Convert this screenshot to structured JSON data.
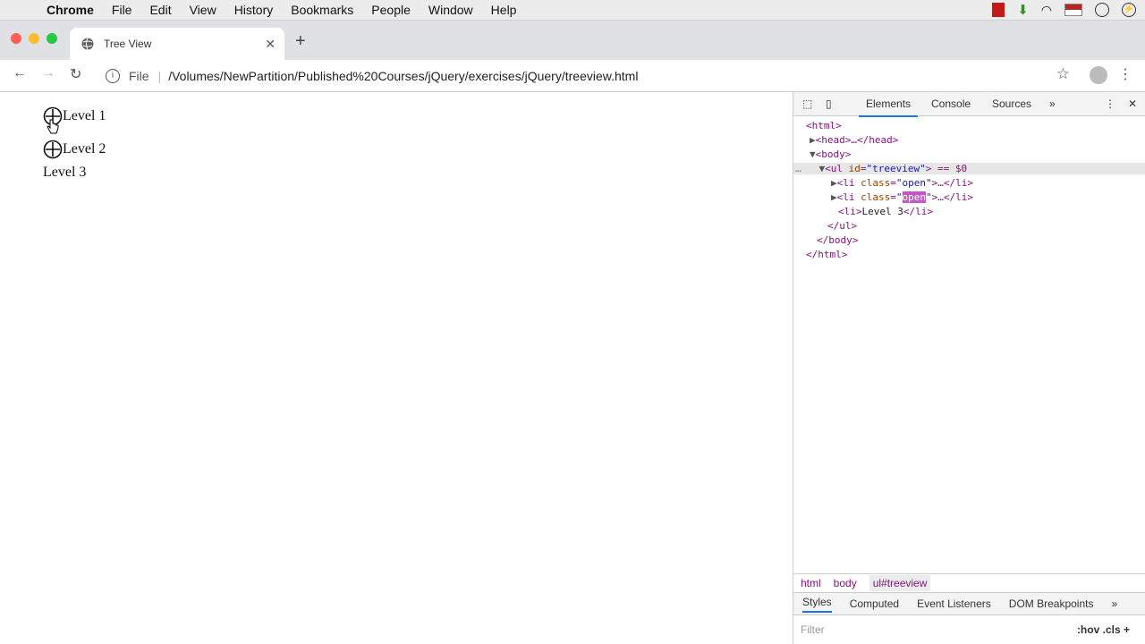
{
  "menubar": {
    "app": "Chrome",
    "items": [
      "File",
      "Edit",
      "View",
      "History",
      "Bookmarks",
      "People",
      "Window",
      "Help"
    ]
  },
  "tab": {
    "title": "Tree View"
  },
  "address": {
    "scheme_label": "File",
    "url": "/Volumes/NewPartition/Published%20Courses/jQuery/exercises/jQuery/treeview.html"
  },
  "tree": {
    "items": [
      "Level 1",
      "Level 2",
      "Level 3"
    ]
  },
  "devtools": {
    "tabs": [
      "Elements",
      "Console",
      "Sources"
    ],
    "dom": {
      "html_open": "<html>",
      "head": "<head>…</head>",
      "body_open": "<body>",
      "ul_open_tag": "<ul ",
      "ul_attr": "id",
      "ul_val": "\"treeview\"",
      "ul_suffix": "> == $0",
      "li1_attr": "class",
      "li1_val": "\"open\"",
      "li1_rest": ">…</li>",
      "li2_attr": "class",
      "li2_val": "open",
      "li2_rest": ">…</li>",
      "li3_tag": "<li>",
      "li3_text": "Level 3",
      "li3_close": "</li>",
      "ul_close": "</ul>",
      "body_close": "</body>",
      "html_close": "</html>"
    },
    "breadcrumbs": [
      "html",
      "body",
      "ul#treeview"
    ],
    "style_tabs": [
      "Styles",
      "Computed",
      "Event Listeners",
      "DOM Breakpoints"
    ],
    "filter_placeholder": "Filter",
    "hov": ":hov",
    "cls": ".cls"
  }
}
